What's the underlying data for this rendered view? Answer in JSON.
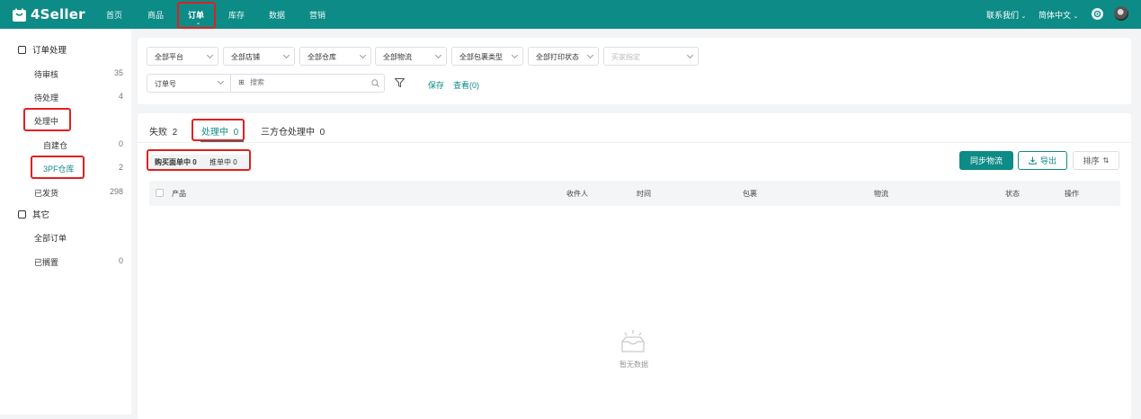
{
  "app": {
    "name": "4Seller"
  },
  "top_nav": {
    "items": [
      "首页",
      "商品",
      "订单",
      "库存",
      "数据",
      "营销"
    ],
    "active": "订单",
    "contact": "联系我们",
    "language": "简体中文"
  },
  "sidebar": {
    "groups": [
      {
        "label": "订单处理",
        "icon": "clipboard-icon"
      },
      {
        "label": "其它",
        "icon": "clipboard-icon"
      }
    ],
    "items": [
      {
        "label": "待审核",
        "count": "35"
      },
      {
        "label": "待处理",
        "count": "4"
      },
      {
        "label": "处理中",
        "count": ""
      },
      {
        "label": "自建仓",
        "count": "0"
      },
      {
        "label": "3PF仓库",
        "count": "2"
      },
      {
        "label": "已发货",
        "count": "298"
      },
      {
        "label": "全部订单",
        "count": ""
      },
      {
        "label": "已搁置",
        "count": "0"
      }
    ]
  },
  "filters": {
    "selects": [
      "全部平台",
      "全部店铺",
      "全部仓库",
      "全部物流",
      "全部包裹类型",
      "全部打印状态"
    ],
    "buyer_placeholder": "买家指定",
    "search_field": "订单号",
    "search_placeholder": "搜索",
    "save": "保存",
    "view": "查看(0)"
  },
  "tabs": [
    {
      "label": "失败",
      "count": "2"
    },
    {
      "label": "处理中",
      "count": "0"
    },
    {
      "label": "三方仓处理中",
      "count": "0"
    }
  ],
  "subtabs": [
    {
      "label": "购买面单中",
      "count": "0"
    },
    {
      "label": "推单中",
      "count": "0"
    }
  ],
  "actions": {
    "sync": "同步物流",
    "export": "导出",
    "sort": "排序"
  },
  "table": {
    "columns": [
      "产品",
      "收件人",
      "时间",
      "包裹",
      "物流",
      "状态",
      "操作"
    ],
    "empty_text": "暂无数据"
  },
  "colors": {
    "brand": "#0d8b87",
    "highlight": "#e02020"
  }
}
